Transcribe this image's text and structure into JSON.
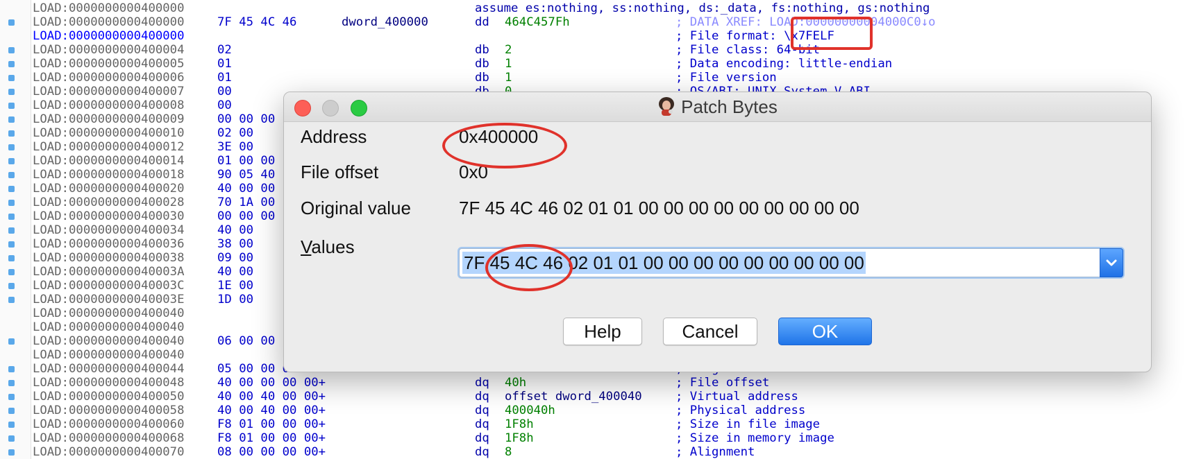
{
  "disassembly": {
    "lines": [
      {
        "addr": "LOAD:0000000000400000",
        "bytes": "",
        "label": "",
        "mnem": "assume es:nothing, ss:nothing, ds:_data, fs:nothing, gs:nothing",
        "op": "",
        "comment": "",
        "dot": false,
        "hl": false
      },
      {
        "addr": "LOAD:0000000000400000",
        "bytes": "7F 45 4C 46",
        "label": "dword_400000",
        "mnem": "dd",
        "op": "464C457Fh",
        "comment": "; DATA XREF: LOAD:00000000004000C0↓o",
        "dot": true,
        "hl": false
      },
      {
        "addr": "LOAD:0000000000400000",
        "bytes": "",
        "label": "",
        "mnem": "",
        "op": "",
        "comment": "; File format: \\x7FELF",
        "dot": false,
        "hl": true
      },
      {
        "addr": "LOAD:0000000000400004",
        "bytes": "02",
        "label": "",
        "mnem": "db",
        "op": "2",
        "comment": "; File class: 64-bit",
        "dot": true,
        "hl": false
      },
      {
        "addr": "LOAD:0000000000400005",
        "bytes": "01",
        "label": "",
        "mnem": "db",
        "op": "1",
        "comment": "; Data encoding: little-endian",
        "dot": true,
        "hl": false
      },
      {
        "addr": "LOAD:0000000000400006",
        "bytes": "01",
        "label": "",
        "mnem": "db",
        "op": "1",
        "comment": "; File version",
        "dot": true,
        "hl": false
      },
      {
        "addr": "LOAD:0000000000400007",
        "bytes": "00",
        "label": "",
        "mnem": "db",
        "op": "0",
        "comment": "; OS/ABI: UNIX System V ABI",
        "dot": true,
        "hl": false
      },
      {
        "addr": "LOAD:0000000000400008",
        "bytes": "00",
        "label": "",
        "mnem": "",
        "op": "",
        "comment": "",
        "dot": true,
        "hl": false
      },
      {
        "addr": "LOAD:0000000000400009",
        "bytes": "00 00 00",
        "label": "",
        "mnem": "",
        "op": "",
        "comment": "",
        "dot": true,
        "hl": false
      },
      {
        "addr": "LOAD:0000000000400010",
        "bytes": "02 00",
        "label": "",
        "mnem": "",
        "op": "",
        "comment": "",
        "dot": true,
        "hl": false
      },
      {
        "addr": "LOAD:0000000000400012",
        "bytes": "3E 00",
        "label": "",
        "mnem": "",
        "op": "",
        "comment": "",
        "dot": true,
        "hl": false
      },
      {
        "addr": "LOAD:0000000000400014",
        "bytes": "01 00 00",
        "label": "",
        "mnem": "",
        "op": "",
        "comment": "",
        "dot": true,
        "hl": false
      },
      {
        "addr": "LOAD:0000000000400018",
        "bytes": "90 05 40",
        "label": "",
        "mnem": "",
        "op": "",
        "comment": "",
        "dot": true,
        "hl": false
      },
      {
        "addr": "LOAD:0000000000400020",
        "bytes": "40 00 00",
        "label": "",
        "mnem": "",
        "op": "",
        "comment": "",
        "dot": true,
        "hl": false
      },
      {
        "addr": "LOAD:0000000000400028",
        "bytes": "70 1A 00",
        "label": "",
        "mnem": "",
        "op": "",
        "comment": "",
        "dot": true,
        "hl": false
      },
      {
        "addr": "LOAD:0000000000400030",
        "bytes": "00 00 00",
        "label": "",
        "mnem": "",
        "op": "",
        "comment": "",
        "dot": true,
        "hl": false
      },
      {
        "addr": "LOAD:0000000000400034",
        "bytes": "40 00",
        "label": "",
        "mnem": "",
        "op": "",
        "comment": "",
        "dot": true,
        "hl": false
      },
      {
        "addr": "LOAD:0000000000400036",
        "bytes": "38 00",
        "label": "",
        "mnem": "",
        "op": "",
        "comment": "",
        "dot": true,
        "hl": false
      },
      {
        "addr": "LOAD:0000000000400038",
        "bytes": "09 00",
        "label": "",
        "mnem": "",
        "op": "",
        "comment": "",
        "dot": true,
        "hl": false
      },
      {
        "addr": "LOAD:000000000040003A",
        "bytes": "40 00",
        "label": "",
        "mnem": "",
        "op": "",
        "comment": "",
        "dot": true,
        "hl": false
      },
      {
        "addr": "LOAD:000000000040003C",
        "bytes": "1E 00",
        "label": "",
        "mnem": "",
        "op": "",
        "comment": "",
        "dot": true,
        "hl": false
      },
      {
        "addr": "LOAD:000000000040003E",
        "bytes": "1D 00",
        "label": "",
        "mnem": "",
        "op": "",
        "comment": "",
        "dot": true,
        "hl": false
      },
      {
        "addr": "LOAD:0000000000400040",
        "bytes": "",
        "label": "",
        "mnem": "",
        "op": "",
        "comment": "",
        "dot": false,
        "hl": false
      },
      {
        "addr": "LOAD:0000000000400040",
        "bytes": "",
        "label": "",
        "mnem": "",
        "op": "",
        "comment": "",
        "dot": false,
        "hl": false
      },
      {
        "addr": "LOAD:0000000000400040",
        "bytes": "06 00 00",
        "label": "",
        "mnem": "",
        "op": "",
        "comment": "",
        "dot": true,
        "hl": false
      },
      {
        "addr": "LOAD:0000000000400040",
        "bytes": "",
        "label": "",
        "mnem": "",
        "op": "",
        "comment": "",
        "dot": false,
        "hl": false
      },
      {
        "addr": "LOAD:0000000000400044",
        "bytes": "05 00 00 00",
        "label": "",
        "mnem": "dd",
        "op": "5",
        "comment": "; Flags",
        "dot": true,
        "hl": false
      },
      {
        "addr": "LOAD:0000000000400048",
        "bytes": "40 00 00 00 00+",
        "label": "",
        "mnem": "dq",
        "op": "40h",
        "comment": "; File offset",
        "dot": true,
        "hl": false
      },
      {
        "addr": "LOAD:0000000000400050",
        "bytes": "40 00 40 00 00+",
        "label": "",
        "mnem": "dq",
        "op": "offset dword_400040",
        "comment": "; Virtual address",
        "dot": true,
        "hl": false
      },
      {
        "addr": "LOAD:0000000000400058",
        "bytes": "40 00 40 00 00+",
        "label": "",
        "mnem": "dq",
        "op": "400040h",
        "comment": "; Physical address",
        "dot": true,
        "hl": false
      },
      {
        "addr": "LOAD:0000000000400060",
        "bytes": "F8 01 00 00 00+",
        "label": "",
        "mnem": "dq",
        "op": "1F8h",
        "comment": "; Size in file image",
        "dot": true,
        "hl": false
      },
      {
        "addr": "LOAD:0000000000400068",
        "bytes": "F8 01 00 00 00+",
        "label": "",
        "mnem": "dq",
        "op": "1F8h",
        "comment": "; Size in memory image",
        "dot": true,
        "hl": false
      },
      {
        "addr": "LOAD:0000000000400070",
        "bytes": "08 00 00 00 00+",
        "label": "",
        "mnem": "dq",
        "op": "8",
        "comment": "; Alignment",
        "dot": true,
        "hl": false
      }
    ]
  },
  "dialog": {
    "title": "Patch Bytes",
    "app_icon": "ida-icon",
    "fields": {
      "address_label": "Address",
      "address_value": "0x400000",
      "file_offset_label": "File offset",
      "file_offset_value": "0x0",
      "original_label": "Original value",
      "original_value": "7F 45 4C 46 02 01 01 00 00 00 00 00 00 00 00 00",
      "values_label_accel": "V",
      "values_label_rest": "alues",
      "values_value": "7F 45 4C 46 02 01 01 00 00 00 00 00 00 00 00 00"
    },
    "buttons": {
      "help": "Help",
      "cancel": "Cancel",
      "ok": "OK"
    }
  },
  "colors": {
    "annotation_red": "#e0322b",
    "ok_button_blue": "#1f74e8",
    "selection": "#b4d5fd"
  }
}
